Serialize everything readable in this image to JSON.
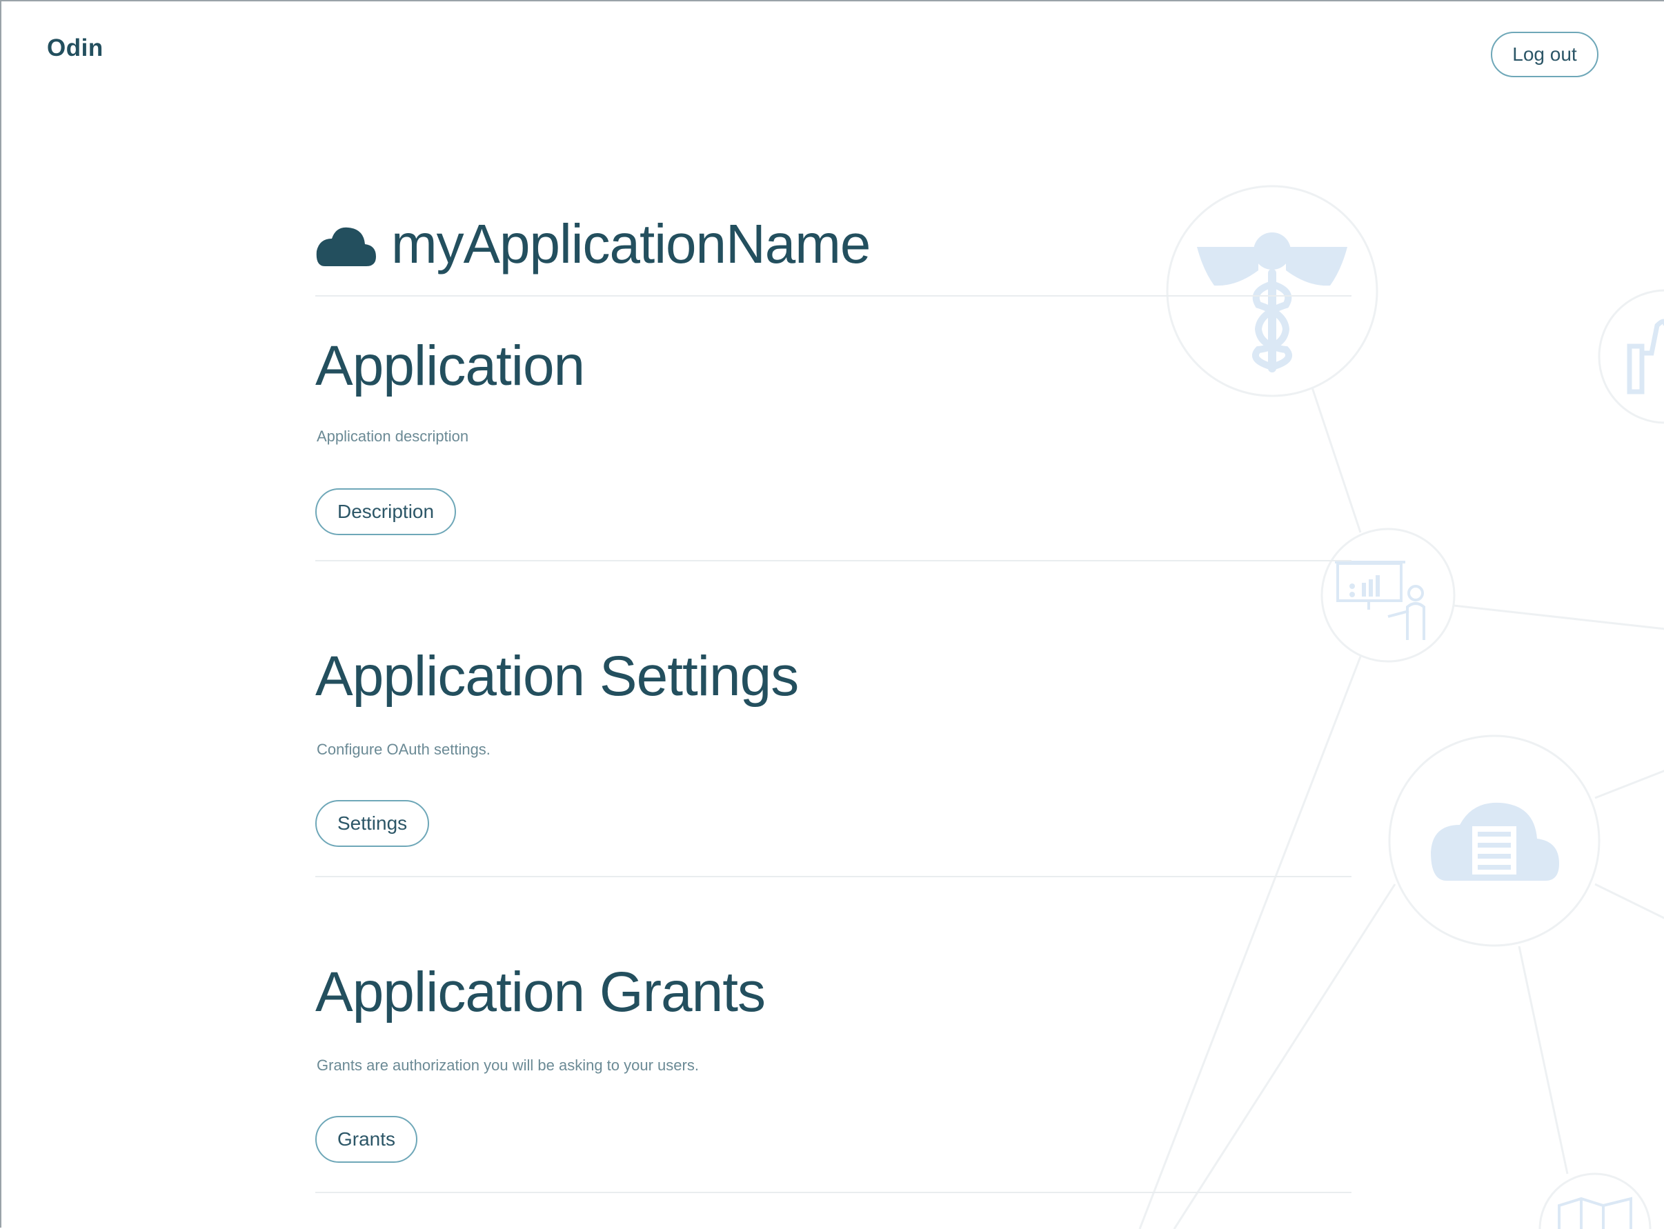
{
  "header": {
    "brand": "Odin",
    "logout_label": "Log out"
  },
  "application": {
    "name": "myApplicationName",
    "icon": "cloud-icon"
  },
  "sections": [
    {
      "title": "Application",
      "description": "Application description",
      "button_label": "Description"
    },
    {
      "title": "Application Settings",
      "description": "Configure OAuth settings.",
      "button_label": "Settings"
    },
    {
      "title": "Application Grants",
      "description": "Grants are authorization you will be asking to your users.",
      "button_label": "Grants"
    }
  ],
  "background_icons": [
    "caduceus-icon",
    "thumbs-up-icon",
    "presentation-icon",
    "cloud-server-icon",
    "map-icon"
  ],
  "colors": {
    "primary_text": "#234f5e",
    "muted_text": "#6b8a95",
    "button_border": "#6ea7b8",
    "divider": "#e9edef",
    "background_art": "#dbe8f5"
  }
}
